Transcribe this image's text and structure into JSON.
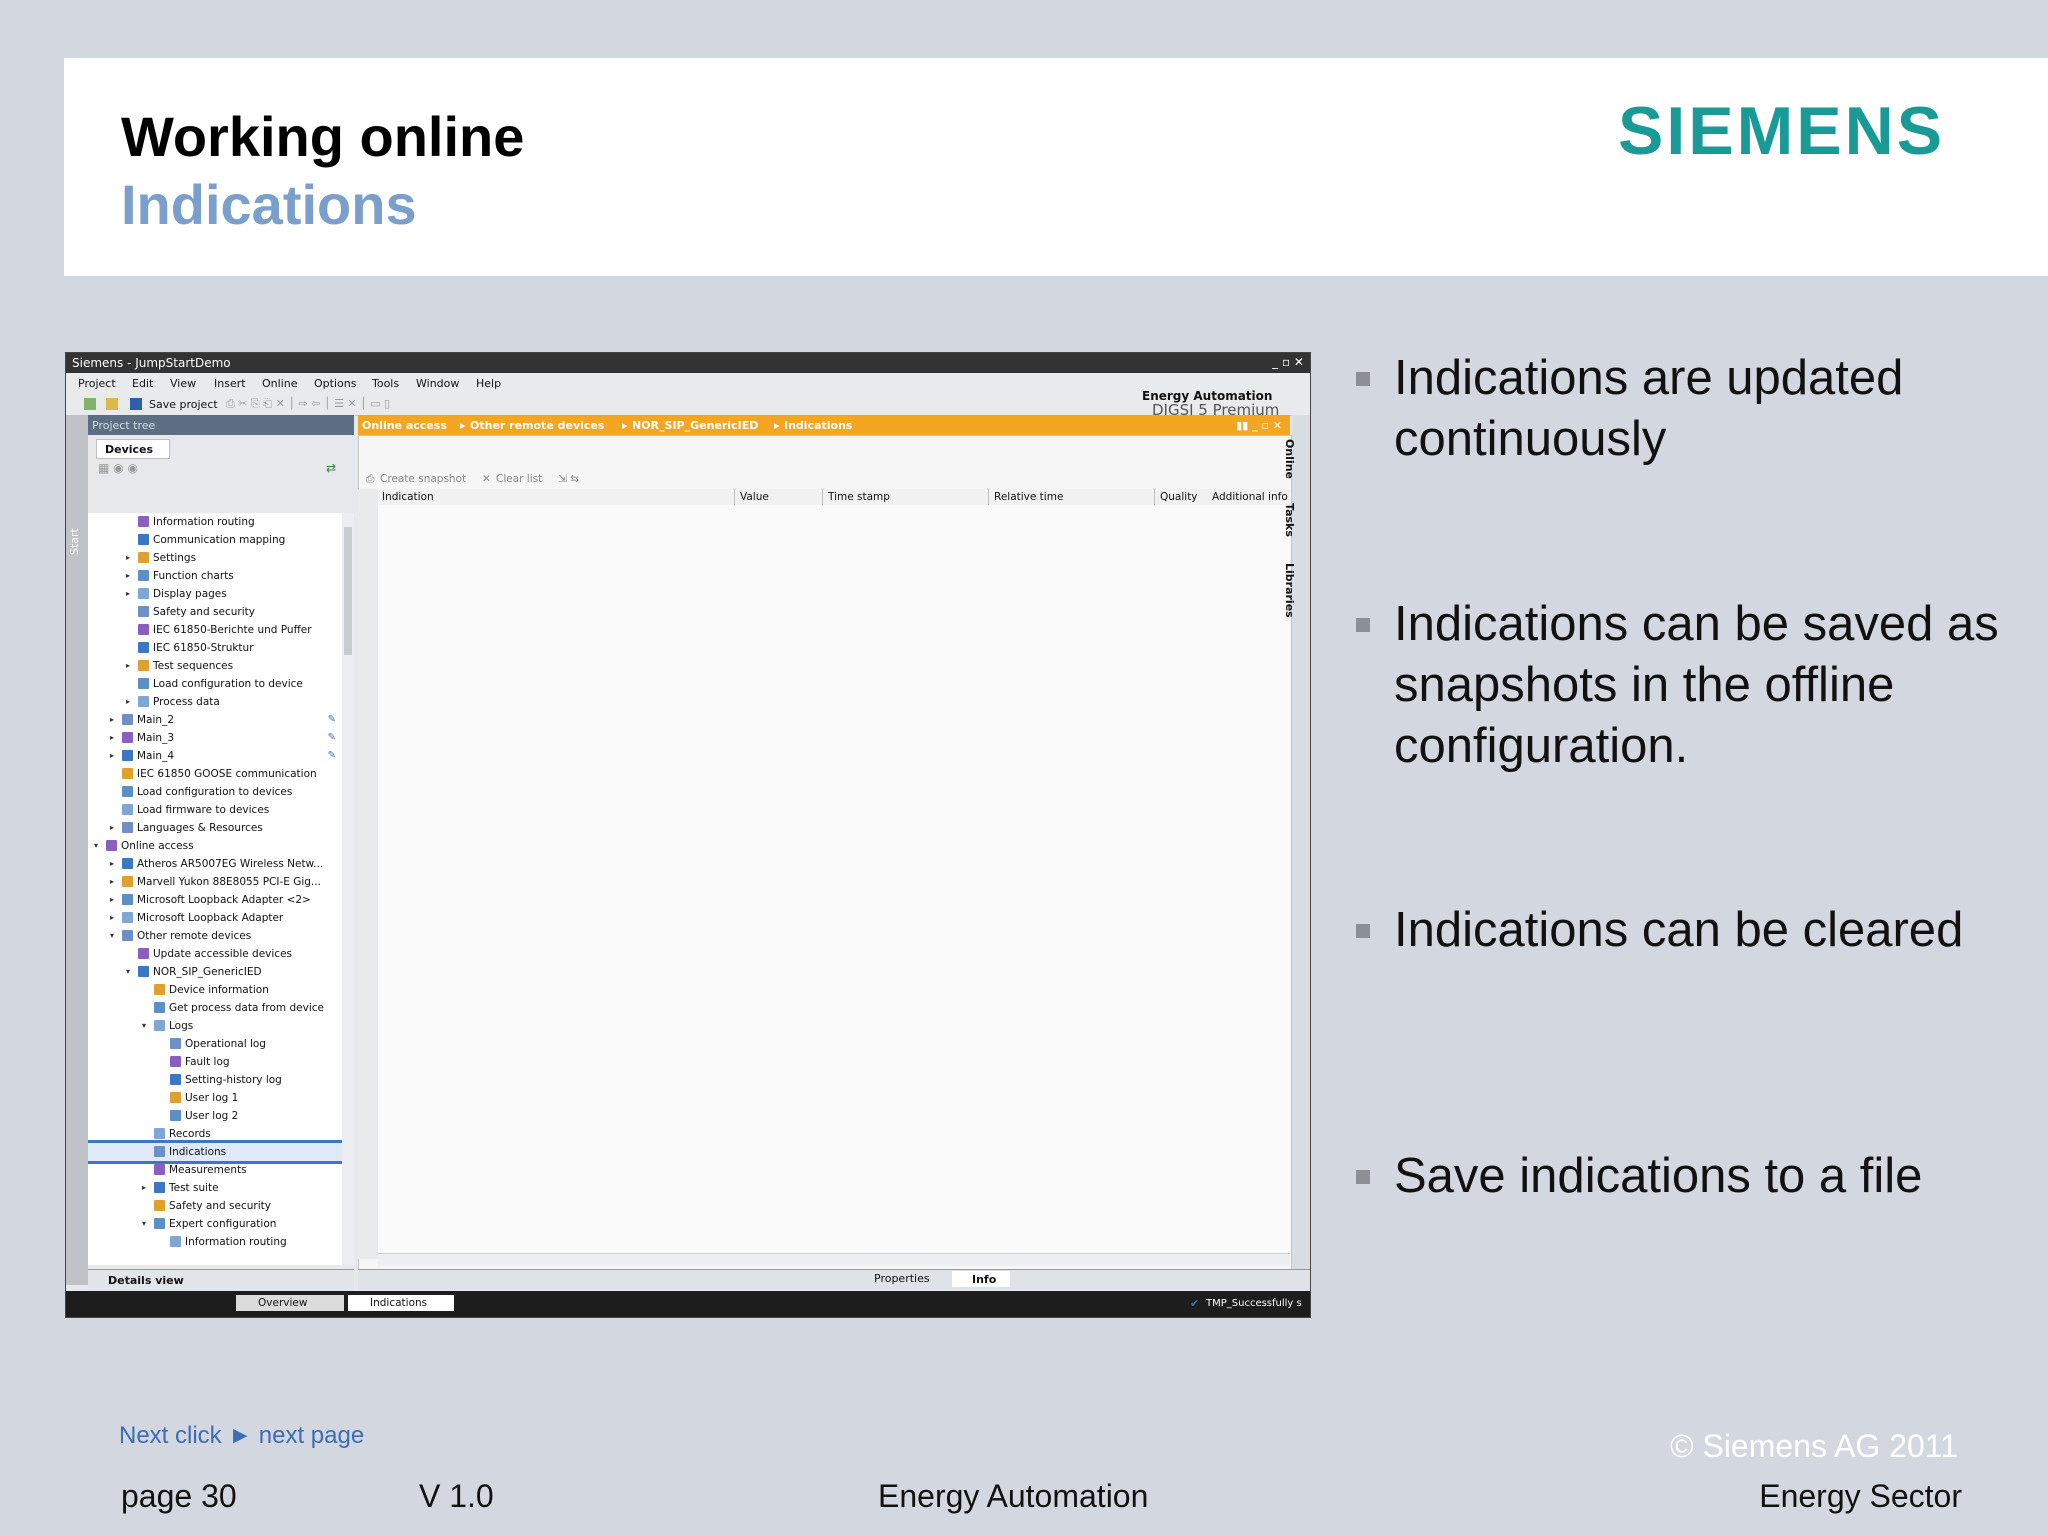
{
  "slide": {
    "title": "Working online",
    "subtitle": "Indications",
    "logo": "SIEMENS",
    "bullets": [
      "Indications are updated continuously",
      "Indications can be saved as snapshots in the offline configuration.",
      "Indications can be cleared",
      "Save indications to a file"
    ],
    "next_click": "Next click ► next page",
    "page": "page 30",
    "version": "V 1.0",
    "center": "Energy Automation",
    "copyright": "© Siemens AG 2011",
    "sector": "Energy Sector"
  },
  "app": {
    "window_title": "Siemens  -  JumpStartDemo",
    "menu": [
      "Project",
      "Edit",
      "View",
      "Insert",
      "Online",
      "Options",
      "Tools",
      "Window",
      "Help"
    ],
    "save_label": "Save project",
    "brand_top": "Energy Automation",
    "brand_bottom": "DIGSI 5 Premium",
    "start_label": "Start",
    "project_tree_title": "Project tree",
    "devices_tab": "Devices",
    "tree": [
      {
        "label": "Information routing",
        "indent": 2,
        "arrow": ""
      },
      {
        "label": "Communication mapping",
        "indent": 2,
        "arrow": ""
      },
      {
        "label": "Settings",
        "indent": 2,
        "arrow": "▸"
      },
      {
        "label": "Function charts",
        "indent": 2,
        "arrow": "▸"
      },
      {
        "label": "Display pages",
        "indent": 2,
        "arrow": "▸"
      },
      {
        "label": "Safety and security",
        "indent": 2,
        "arrow": ""
      },
      {
        "label": "IEC 61850-Berichte und Puffer",
        "indent": 2,
        "arrow": ""
      },
      {
        "label": "IEC 61850-Struktur",
        "indent": 2,
        "arrow": ""
      },
      {
        "label": "Test sequences",
        "indent": 2,
        "arrow": "▸"
      },
      {
        "label": "Load configuration to device",
        "indent": 2,
        "arrow": ""
      },
      {
        "label": "Process data",
        "indent": 2,
        "arrow": "▸"
      },
      {
        "label": "Main_2",
        "indent": 1,
        "arrow": "▸",
        "pen": true
      },
      {
        "label": "Main_3",
        "indent": 1,
        "arrow": "▸",
        "pen": true
      },
      {
        "label": "Main_4",
        "indent": 1,
        "arrow": "▸",
        "pen": true
      },
      {
        "label": "IEC 61850 GOOSE communication",
        "indent": 1,
        "arrow": ""
      },
      {
        "label": "Load configuration to devices",
        "indent": 1,
        "arrow": ""
      },
      {
        "label": "Load firmware to devices",
        "indent": 1,
        "arrow": ""
      },
      {
        "label": "Languages & Resources",
        "indent": 1,
        "arrow": "▸"
      },
      {
        "label": "Online access",
        "indent": 0,
        "arrow": "▾"
      },
      {
        "label": "Atheros AR5007EG Wireless Netw...",
        "indent": 1,
        "arrow": "▸"
      },
      {
        "label": "Marvell Yukon 88E8055 PCI-E Gig...",
        "indent": 1,
        "arrow": "▸"
      },
      {
        "label": "Microsoft Loopback Adapter <2>",
        "indent": 1,
        "arrow": "▸"
      },
      {
        "label": "Microsoft Loopback Adapter",
        "indent": 1,
        "arrow": "▸"
      },
      {
        "label": "Other remote devices",
        "indent": 1,
        "arrow": "▾"
      },
      {
        "label": "Update accessible devices",
        "indent": 2,
        "arrow": ""
      },
      {
        "label": "NOR_SIP_GenericIED",
        "indent": 2,
        "arrow": "▾"
      },
      {
        "label": "Device information",
        "indent": 3,
        "arrow": ""
      },
      {
        "label": "Get process data from device",
        "indent": 3,
        "arrow": ""
      },
      {
        "label": "Logs",
        "indent": 3,
        "arrow": "▾"
      },
      {
        "label": "Operational log",
        "indent": 4,
        "arrow": ""
      },
      {
        "label": "Fault log",
        "indent": 4,
        "arrow": ""
      },
      {
        "label": "Setting-history log",
        "indent": 4,
        "arrow": ""
      },
      {
        "label": "User log 1",
        "indent": 4,
        "arrow": ""
      },
      {
        "label": "User log 2",
        "indent": 4,
        "arrow": ""
      },
      {
        "label": "Records",
        "indent": 3,
        "arrow": ""
      },
      {
        "label": "Indications",
        "indent": 3,
        "arrow": "",
        "selected": true
      },
      {
        "label": "Measurements",
        "indent": 3,
        "arrow": ""
      },
      {
        "label": "Test suite",
        "indent": 3,
        "arrow": "▸"
      },
      {
        "label": "Safety and security",
        "indent": 3,
        "arrow": ""
      },
      {
        "label": "Expert configuration",
        "indent": 3,
        "arrow": "▾"
      },
      {
        "label": "Information routing",
        "indent": 4,
        "arrow": ""
      }
    ],
    "details_view": "Details view",
    "breadcrumb": [
      "Online access",
      "Other remote devices",
      "NOR_SIP_GenericIED",
      "Indications"
    ],
    "create_snapshot": "Create snapshot",
    "clear_list": "Clear list",
    "columns": [
      "Indication",
      "Value",
      "Time stamp",
      "Relative time",
      "Quality",
      "Additional info"
    ],
    "right_tabs": [
      "Online",
      "Tasks",
      "Libraries"
    ],
    "properties": "Properties",
    "info": "Info",
    "status_overview": "Overview",
    "status_indications": "Indications",
    "status_msg": "TMP_Successfully s"
  }
}
